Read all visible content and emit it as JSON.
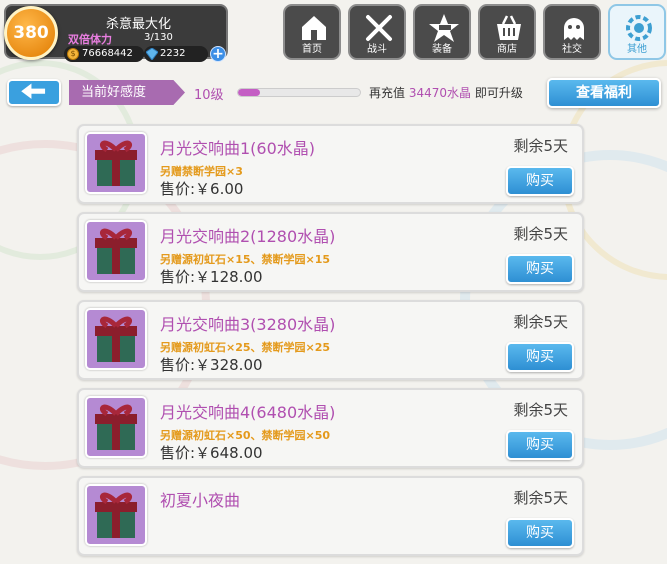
{
  "player": {
    "level": "380",
    "name": "杀意最大化",
    "stamina_label": "双倍体力",
    "stamina_value": "3/130",
    "coins": "76668442",
    "gems": "2232",
    "add_label": "+"
  },
  "nav": [
    {
      "label": "首页",
      "icon": "house-icon"
    },
    {
      "label": "战斗",
      "icon": "crossed-swords-icon"
    },
    {
      "label": "装备",
      "icon": "star-gun-icon"
    },
    {
      "label": "商店",
      "icon": "shopping-basket-icon"
    },
    {
      "label": "社交",
      "icon": "ghost-chat-icon"
    },
    {
      "label": "其他",
      "icon": "gear-swirl-icon",
      "active": true
    }
  ],
  "favor": {
    "label": "当前好感度",
    "level": "10级",
    "progress": 0.18,
    "recharge_prefix": "再充值",
    "recharge_amount": "34470水晶",
    "recharge_suffix": "即可升级",
    "welfare_button": "查看福利"
  },
  "items": [
    {
      "title": "月光交响曲1(60水晶)",
      "bonus": "另赠禁断学园×3",
      "price": "售价:￥6.00",
      "remaining": "剩余5天",
      "buy": "购买"
    },
    {
      "title": "月光交响曲2(1280水晶)",
      "bonus": "另赠源初虹石×15、禁断学园×15",
      "price": "售价:￥128.00",
      "remaining": "剩余5天",
      "buy": "购买"
    },
    {
      "title": "月光交响曲3(3280水晶)",
      "bonus": "另赠源初虹石×25、禁断学园×25",
      "price": "售价:￥328.00",
      "remaining": "剩余5天",
      "buy": "购买"
    },
    {
      "title": "月光交响曲4(6480水晶)",
      "bonus": "另赠源初虹石×50、禁断学园×50",
      "price": "售价:￥648.00",
      "remaining": "剩余5天",
      "buy": "购买"
    },
    {
      "title": "初夏小夜曲",
      "bonus": "",
      "price": "",
      "remaining": "剩余5天",
      "buy": "购买"
    }
  ],
  "colors": {
    "accent_blue": "#3aa0df",
    "title_purple": "#b04fb0",
    "bonus_orange": "#e49a1c",
    "favor_purple": "#a86bb0"
  }
}
